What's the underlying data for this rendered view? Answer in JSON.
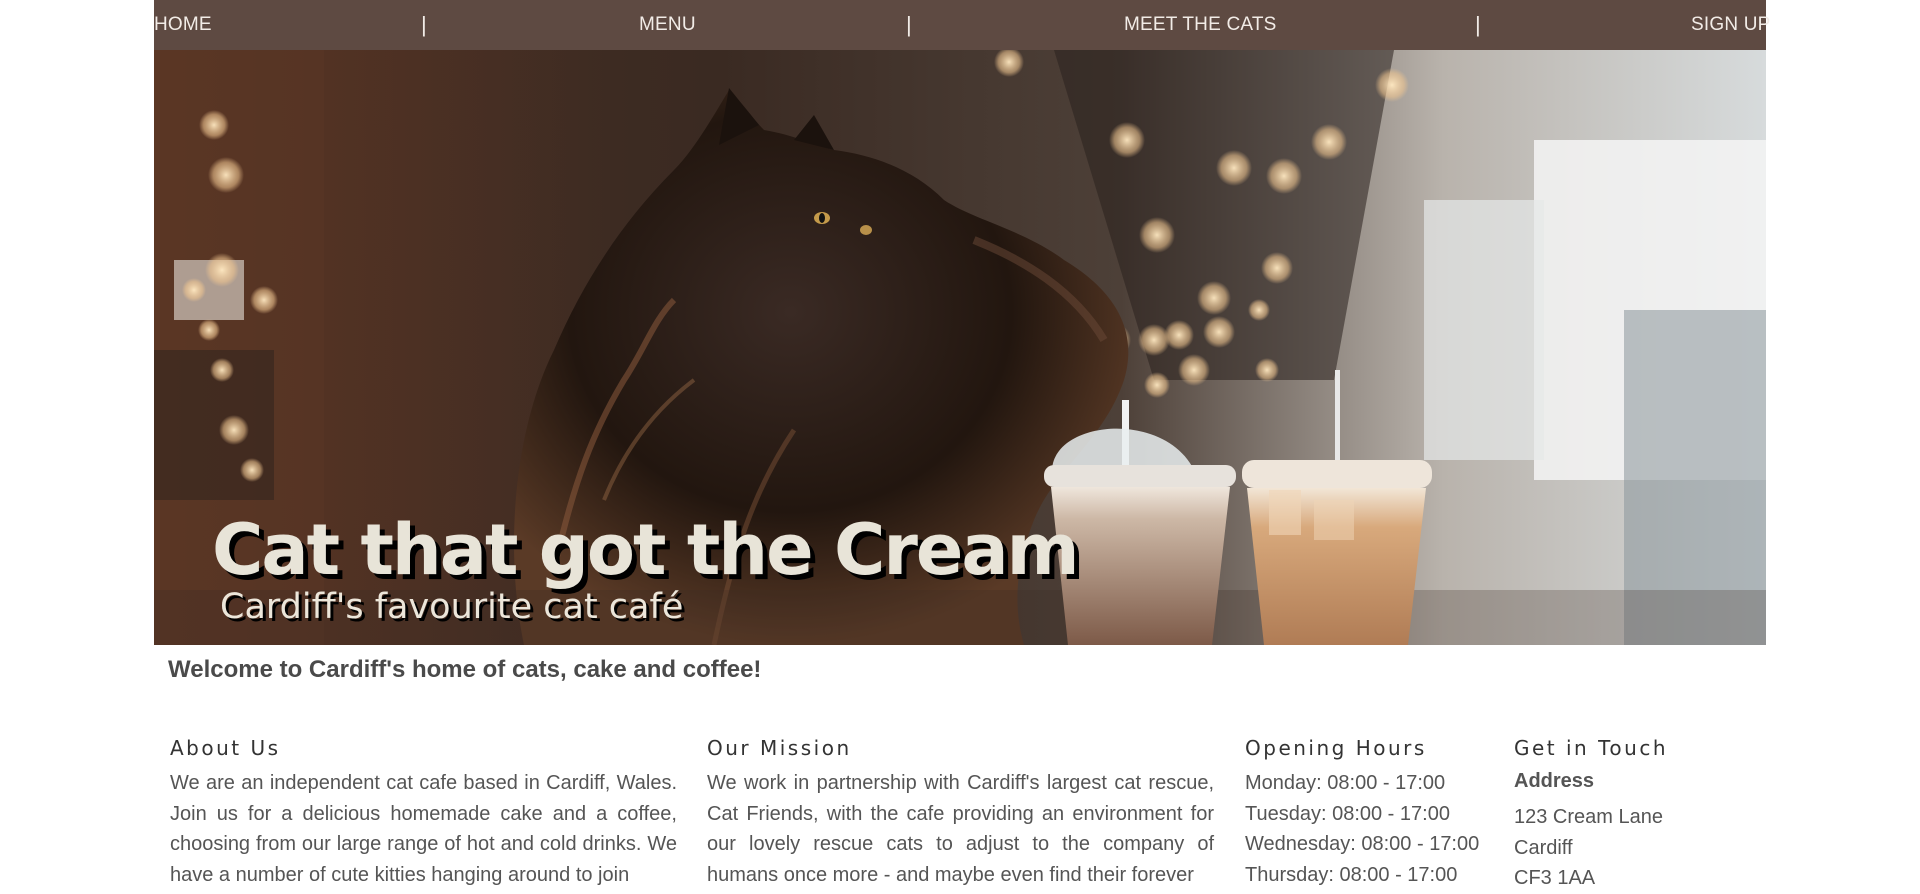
{
  "nav": {
    "items": [
      "HOME",
      "MENU",
      "MEET THE CATS",
      "SIGN UP"
    ],
    "separator": "|"
  },
  "hero": {
    "title": "Cat that got the Cream",
    "subtitle": "Cardiff's favourite cat café",
    "image_subject": "fluffy-cat-with-iced-coffees"
  },
  "welcome": "Welcome to Cardiff's home of cats, cake and coffee!",
  "about": {
    "heading": "About Us",
    "text": "We are an independent cat cafe based in Cardiff, Wales. Join us for a delicious homemade cake and a coffee, choosing from our large range of hot and cold drinks. We have a number of cute kitties hanging around to join"
  },
  "mission": {
    "heading": "Our Mission",
    "text": "We work in partnership with Cardiff's largest cat rescue, Cat Friends, with the cafe providing an environment for our lovely rescue cats to adjust to the company of humans once more - and maybe even find their forever"
  },
  "hours": {
    "heading": "Opening Hours",
    "lines": [
      "Monday: 08:00 - 17:00",
      "Tuesday: 08:00 - 17:00",
      "Wednesday: 08:00 - 17:00",
      "Thursday: 08:00 - 17:00"
    ]
  },
  "contact": {
    "heading": "Get in Touch",
    "address_label": "Address",
    "address_lines": [
      "123 Cream Lane",
      "Cardiff",
      "CF3 1AA"
    ]
  },
  "colors": {
    "nav_bg": "#5e4a42",
    "nav_text": "#f2ece7",
    "hero_title": "#e8e4d8",
    "body_text": "#555555"
  }
}
